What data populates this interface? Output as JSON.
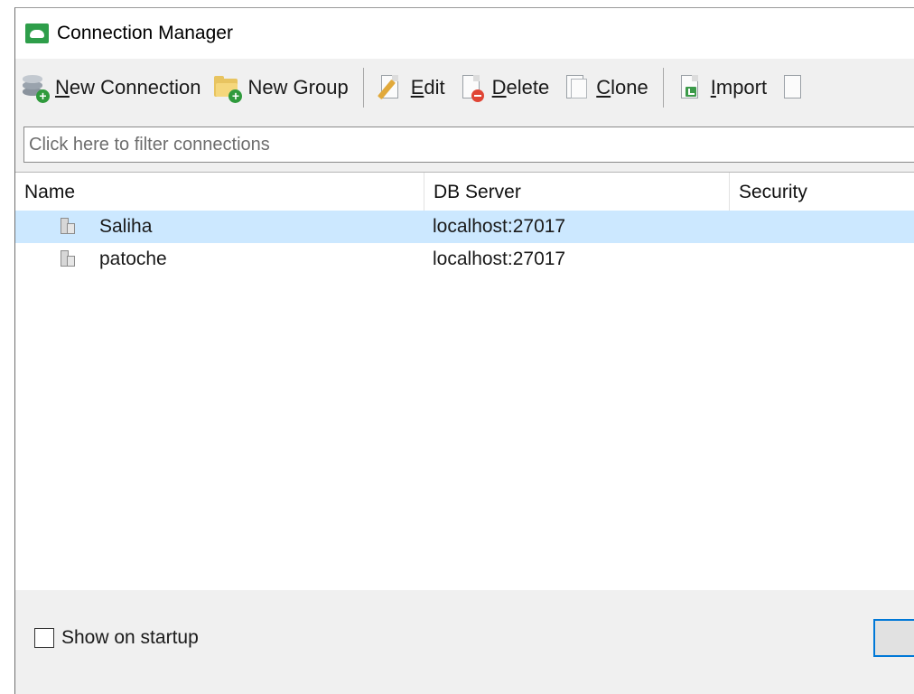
{
  "window": {
    "title": "Connection Manager"
  },
  "toolbar": {
    "new_connection": "New Connection",
    "new_group": "New Group",
    "edit": "Edit",
    "delete": "Delete",
    "clone": "Clone",
    "import": "Import"
  },
  "filter": {
    "placeholder": "Click here to filter connections",
    "value": ""
  },
  "table": {
    "columns": [
      "Name",
      "DB Server",
      "Security"
    ],
    "rows": [
      {
        "name": "Saliha",
        "server": "localhost:27017",
        "security": "",
        "selected": true
      },
      {
        "name": "patoche",
        "server": "localhost:27017",
        "security": "",
        "selected": false
      }
    ]
  },
  "footer": {
    "show_on_startup": "Show on startup",
    "show_on_startup_checked": false
  },
  "colors": {
    "selection": "#cce8ff",
    "accent": "#0078d7",
    "app_icon": "#2e9e4a"
  }
}
